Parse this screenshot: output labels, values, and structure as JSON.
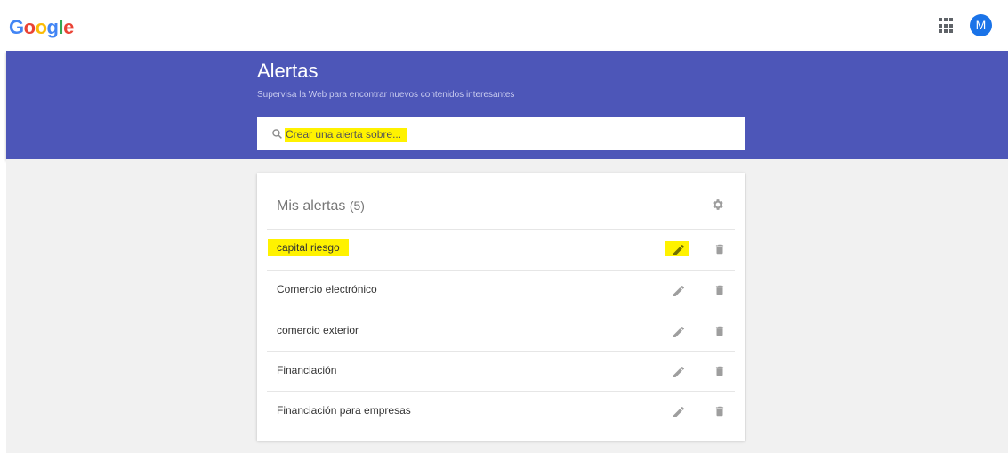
{
  "header": {
    "logo_letters": [
      {
        "char": "G",
        "color": "#4285F4"
      },
      {
        "char": "o",
        "color": "#EA4335"
      },
      {
        "char": "o",
        "color": "#FBBC05"
      },
      {
        "char": "g",
        "color": "#4285F4"
      },
      {
        "char": "l",
        "color": "#34A853"
      },
      {
        "char": "e",
        "color": "#EA4335"
      }
    ],
    "apps_icon": "apps-grid-icon",
    "avatar_initial": "M"
  },
  "banner": {
    "title": "Alertas",
    "subtitle": "Supervisa la Web para encontrar nuevos contenidos interesantes",
    "color": "#4d56b8"
  },
  "search": {
    "placeholder": "Crear una alerta sobre...",
    "icon": "search-icon"
  },
  "alerts": {
    "title": "Mis alertas",
    "count": "(5)",
    "settings_icon": "gear-icon",
    "items": [
      {
        "label": "capital riesgo",
        "highlighted": true
      },
      {
        "label": "Comercio electrónico",
        "highlighted": false
      },
      {
        "label": "comercio exterior",
        "highlighted": false
      },
      {
        "label": "Financiación",
        "highlighted": false
      },
      {
        "label": "Financiación para empresas",
        "highlighted": false
      }
    ],
    "edit_icon": "pencil-icon",
    "delete_icon": "trash-icon"
  },
  "highlight_color": "#fff200"
}
